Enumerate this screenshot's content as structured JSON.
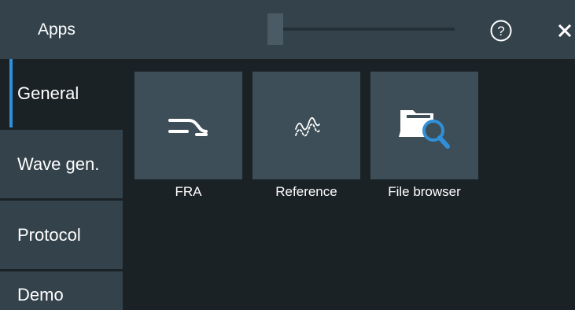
{
  "header": {
    "title": "Apps",
    "help_icon": "help-circle-icon",
    "close_icon": "close-icon"
  },
  "sidebar": {
    "items": [
      {
        "label": "General",
        "active": true
      },
      {
        "label": "Wave gen.",
        "active": false
      },
      {
        "label": "Protocol",
        "active": false
      },
      {
        "label": "Demo",
        "active": false
      }
    ]
  },
  "apps": [
    {
      "label": "FRA",
      "icon": "fra-step-icon"
    },
    {
      "label": "Reference",
      "icon": "reference-waveform-icon"
    },
    {
      "label": "File browser",
      "icon": "folder-search-icon"
    }
  ],
  "colors": {
    "background": "#1b2226",
    "panel": "#33424b",
    "tile": "#3d4e58",
    "accent": "#2f8fd8"
  }
}
